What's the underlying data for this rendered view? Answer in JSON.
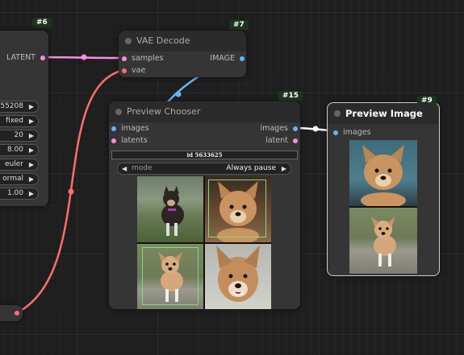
{
  "node6": {
    "badge": "#6",
    "output_label": "LATENT",
    "widgets": [
      {
        "value": "55208"
      },
      {
        "value": "fixed"
      },
      {
        "value": "20"
      },
      {
        "value": "8.00"
      },
      {
        "value": "euler"
      },
      {
        "value": "ormal"
      },
      {
        "value": "1.00"
      }
    ]
  },
  "node7": {
    "title": "VAE Decode",
    "badge": "#7",
    "inputs": [
      "samples",
      "vae"
    ],
    "output_label": "IMAGE"
  },
  "node15": {
    "title": "Preview Chooser",
    "badge": "#15",
    "inputs": [
      "images",
      "latents"
    ],
    "outputs": [
      "images",
      "latent"
    ],
    "id_text": "id 5633625",
    "mode_label": "mode",
    "mode_value": "Always pause"
  },
  "node9": {
    "title": "Preview Image",
    "badge": "#9",
    "inputs": [
      "images"
    ]
  },
  "colors": {
    "latent": "#ff8ce0",
    "image": "#64b5f6",
    "vae": "#ff6e6e",
    "selected_border": "#7fdc7f"
  },
  "icons": {
    "arrow_left": "◀",
    "arrow_right": "▶"
  }
}
